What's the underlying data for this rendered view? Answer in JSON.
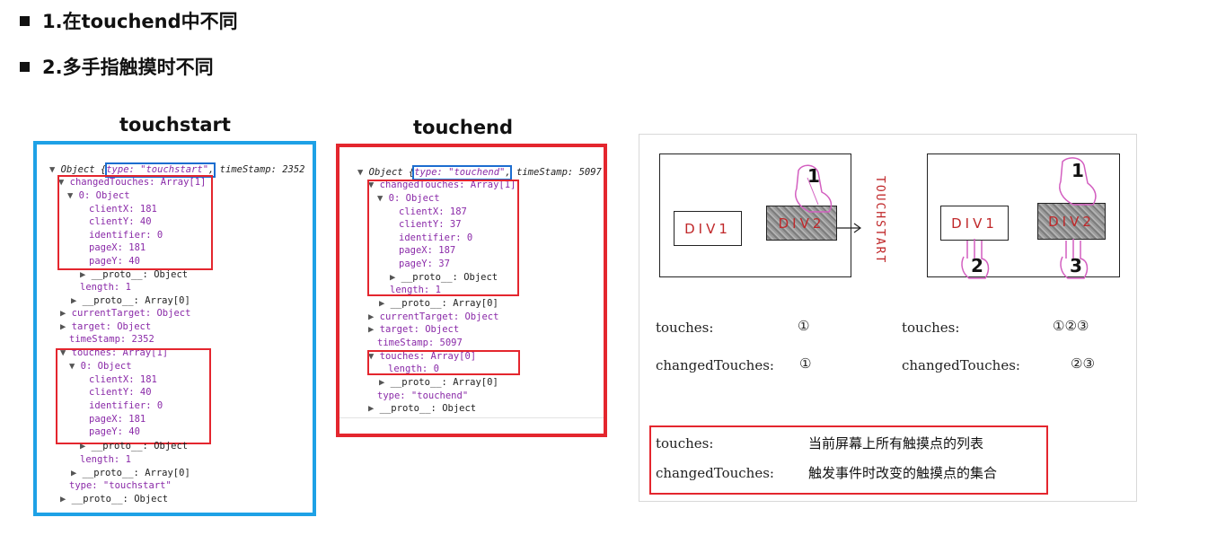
{
  "bullets": [
    {
      "text": "1.在touchend中不同"
    },
    {
      "text": "2.多手指触摸时不同"
    }
  ],
  "touchstart": {
    "heading": "touchstart",
    "lines": {
      "l1a": "Object {",
      "l1b": "type: \"touchstart\"",
      "l1c": ", timeStamp: 2352",
      "l2": "changedTouches: Array[1]",
      "l3": "0: Object",
      "l4": "clientX: 181",
      "l5": "clientY: 40",
      "l6": "identifier: 0",
      "l7": "pageX: 181",
      "l8": "pageY: 40",
      "l9": "__proto__: Object",
      "l10": "length: 1",
      "l11": "__proto__: Array[0]",
      "l12": "currentTarget: Object",
      "l13": "target: Object",
      "l14": "timeStamp: 2352",
      "l15": "touches: Array[1]",
      "l16": "0: Object",
      "l17": "clientX: 181",
      "l18": "clientY: 40",
      "l19": "identifier: 0",
      "l20": "pageX: 181",
      "l21": "pageY: 40",
      "l22": "__proto__: Object",
      "l23": "length: 1",
      "l24": "__proto__: Array[0]",
      "l25": "type: \"touchstart\"",
      "l26": "__proto__: Object"
    }
  },
  "touchend": {
    "heading": "touchend",
    "lines": {
      "l1a": "Object {",
      "l1b": "type: \"touchend\"",
      "l1c": ", timeStamp: 5097",
      "l2": "changedTouches: Array[1]",
      "l3": "0: Object",
      "l4": "clientX: 187",
      "l5": "clientY: 37",
      "l6": "identifier: 0",
      "l7": "pageX: 187",
      "l8": "pageY: 37",
      "l9": "__proto__: Object",
      "l10": "length: 1",
      "l11": "__proto__: Array[0]",
      "l12": "currentTarget: Object",
      "l13": "target: Object",
      "l14": "timeStamp: 5097",
      "l15": "touches: Array[0]",
      "l16": "length: 0",
      "l17": "__proto__: Array[0]",
      "l18": "type: \"touchend\"",
      "l19": "__proto__: Object"
    }
  },
  "diagram": {
    "div1": "DIV1",
    "div2": "DIV2",
    "vertical": "TOUCHSTART",
    "left_touches_label": "touches:",
    "left_touches_value": "①",
    "left_changed_label": "changedTouches:",
    "left_changed_value": "①",
    "right_touches_label": "touches:",
    "right_touches_value": "①②③",
    "right_changed_label": "changedTouches:",
    "right_changed_value": "②③",
    "def_touches_label": "touches:",
    "def_touches_text": "当前屏幕上所有触摸点的列表",
    "def_changed_label": "changedTouches:",
    "def_changed_text": "触发事件时改变的触摸点的集合",
    "finger1": "1",
    "finger2": "2",
    "finger3": "3"
  },
  "colors": {
    "blue_frame": "#1ea1e6",
    "red_frame": "#e4262e"
  }
}
